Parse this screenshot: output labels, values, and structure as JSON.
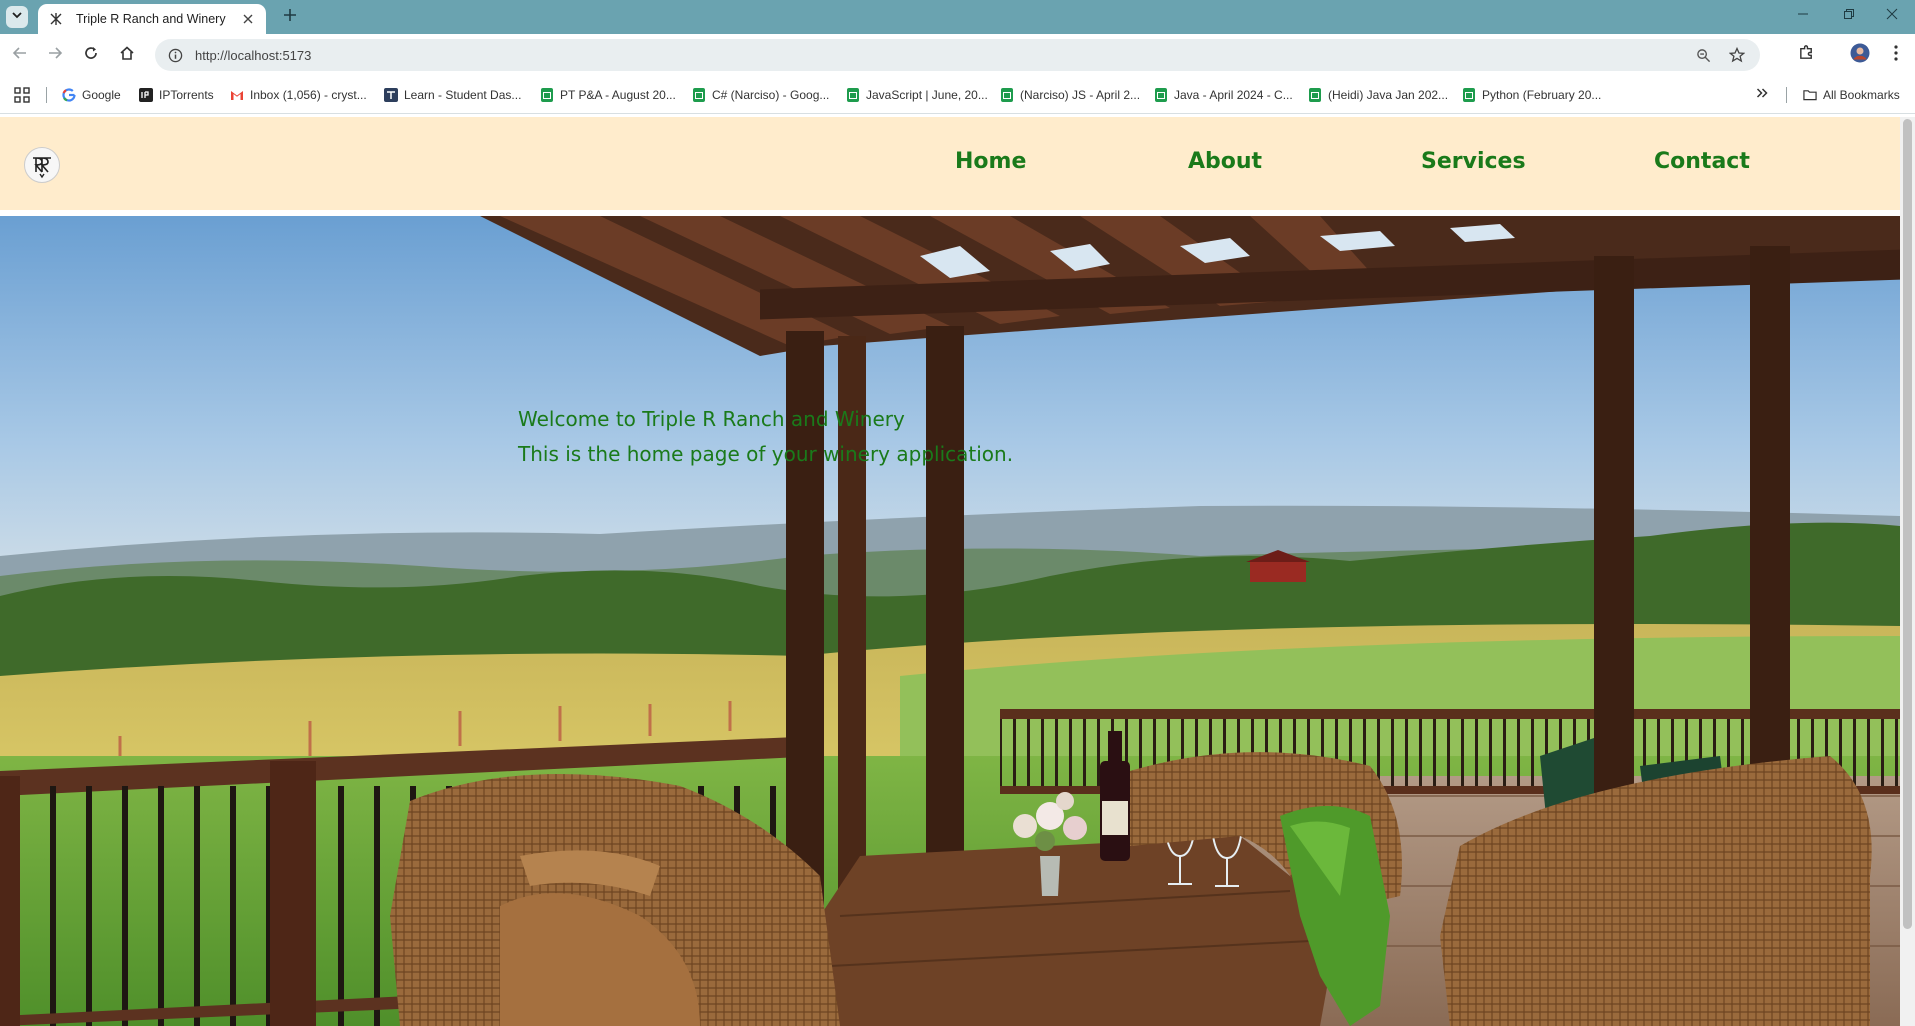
{
  "browser": {
    "tab": {
      "title": "Triple R Ranch and Winery"
    },
    "url": "http://localhost:5173",
    "bookmarks": [
      {
        "label": "Google",
        "icon": "google-icon"
      },
      {
        "label": "IPTorrents",
        "icon": "ipt-icon"
      },
      {
        "label": "Inbox (1,056) - cryst...",
        "icon": "gmail-icon"
      },
      {
        "label": "Learn - Student Das...",
        "icon": "learn-icon"
      },
      {
        "label": "PT P&A - August 20...",
        "icon": "sheets-icon"
      },
      {
        "label": "C# (Narciso) - Goog...",
        "icon": "sheets-icon"
      },
      {
        "label": "JavaScript | June, 20...",
        "icon": "sheets-icon"
      },
      {
        "label": "(Narciso) JS - April 2...",
        "icon": "sheets-icon"
      },
      {
        "label": "Java - April 2024 - C...",
        "icon": "sheets-icon"
      },
      {
        "label": "(Heidi) Java Jan 202...",
        "icon": "sheets-icon"
      },
      {
        "label": "Python (February 20...",
        "icon": "sheets-icon"
      }
    ],
    "all_bookmarks": "All Bookmarks"
  },
  "site": {
    "nav": {
      "home": "Home",
      "about": "About",
      "services": "Services",
      "contact": "Contact"
    },
    "hero": {
      "line1": "Welcome to Triple R Ranch and Winery",
      "line2": "This is the home page of your winery application."
    }
  },
  "colors": {
    "tabstrip": "#6aa3b0",
    "header_bg": "#ffeccc",
    "nav_text": "#1a7a1a"
  }
}
